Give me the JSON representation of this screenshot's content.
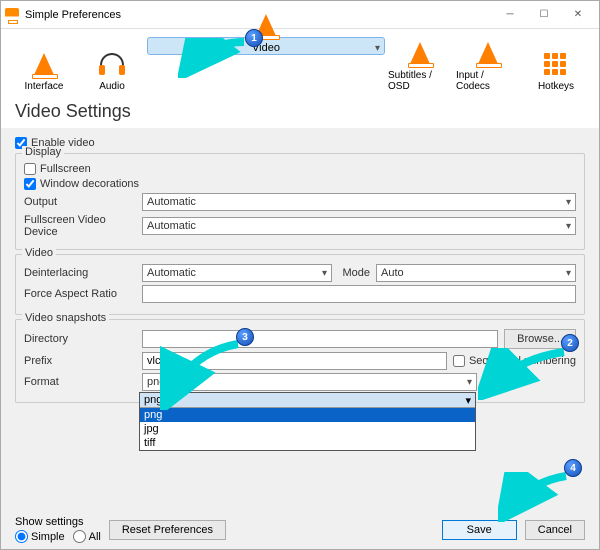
{
  "window": {
    "title": "Simple Preferences"
  },
  "toolbar": {
    "interface": "Interface",
    "audio": "Audio",
    "video": "Video",
    "subtitles": "Subtitles / OSD",
    "input": "Input / Codecs",
    "hotkeys": "Hotkeys"
  },
  "heading": "Video Settings",
  "enable_video": "Enable video",
  "display": {
    "title": "Display",
    "fullscreen": "Fullscreen",
    "windec": "Window decorations",
    "output": "Output",
    "output_val": "Automatic",
    "fsdev": "Fullscreen Video Device",
    "fsdev_val": "Automatic"
  },
  "video": {
    "title": "Video",
    "deint": "Deinterlacing",
    "deint_val": "Automatic",
    "mode": "Mode",
    "mode_val": "Auto",
    "far": "Force Aspect Ratio",
    "far_val": ""
  },
  "snap": {
    "title": "Video snapshots",
    "dir": "Directory",
    "dir_val": "",
    "browse": "Browse...",
    "prefix": "Prefix",
    "prefix_val": "vlcsnap-",
    "seq": "Sequential numbering",
    "format": "Format",
    "format_val": "png",
    "opts": [
      "png",
      "jpg",
      "tiff"
    ]
  },
  "footer": {
    "show": "Show settings",
    "simple": "Simple",
    "all": "All",
    "reset": "Reset Preferences",
    "save": "Save",
    "cancel": "Cancel"
  },
  "callouts": [
    "1",
    "2",
    "3",
    "4"
  ]
}
